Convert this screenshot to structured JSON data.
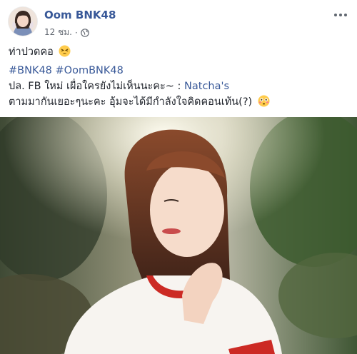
{
  "post": {
    "author": "Oom BNK48",
    "timestamp": "12 ชม.",
    "separator": "·",
    "privacy_icon": "globe-icon",
    "more_icon": "more-options-icon",
    "line1": "ท่าปวดคอ",
    "line1_emoji": "tired-face-emoji",
    "hashtags": "#BNK48 #OomBNK48",
    "line3_prefix": "ปล. FB ใหม่ เผื่อใครยังไม่เห็นนะคะ~ : ",
    "line3_link": "Natcha's",
    "line4": "ตามมากันเยอะๆนะคะ อุ้มจะได้มีกำลังใจคิดคอนเท้น(?)",
    "line4_emoji": "flushed-face-emoji"
  },
  "colors": {
    "link": "#385898",
    "text": "#1d2129",
    "meta": "#616770"
  }
}
